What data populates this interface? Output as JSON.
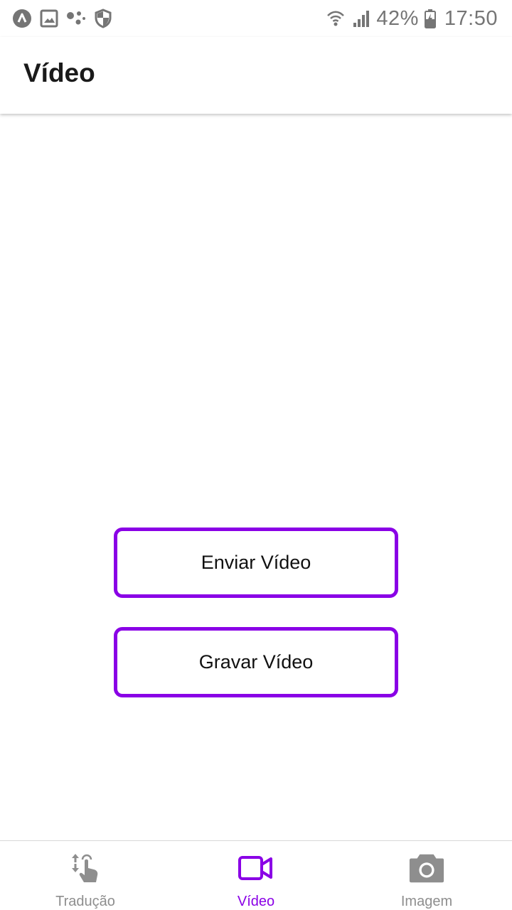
{
  "status_bar": {
    "left_icons": [
      "android-system-icon",
      "image-icon",
      "assistant-dots-icon",
      "shield-icon"
    ],
    "right_icons": [
      "wifi-icon",
      "signal-icon",
      "battery-icon"
    ],
    "battery": "42%",
    "time": "17:50",
    "color": "#757575"
  },
  "app_bar": {
    "title": "Vídeo"
  },
  "main": {
    "buttons": [
      {
        "label": "Enviar Vídeo"
      },
      {
        "label": "Gravar Vídeo"
      }
    ],
    "accent_color": "#8a00e6"
  },
  "bottom_nav": {
    "active_index": 1,
    "active_color": "#8a00e6",
    "inactive_color": "#8e8e8e",
    "tabs": [
      {
        "label": "Tradução",
        "icon": "touch-swap-icon"
      },
      {
        "label": "Vídeo",
        "icon": "video-camera-icon"
      },
      {
        "label": "Imagem",
        "icon": "photo-camera-icon"
      }
    ]
  }
}
